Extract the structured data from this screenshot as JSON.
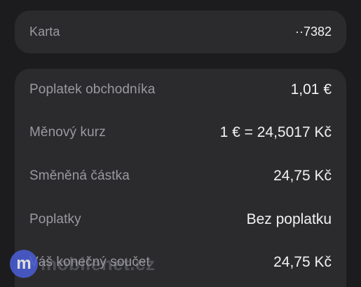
{
  "card_section": {
    "label": "Karta",
    "value": "··7382"
  },
  "details": {
    "rows": [
      {
        "label": "Poplatek obchodníka",
        "value": "1,01 €"
      },
      {
        "label": "Měnový kurz",
        "value": "1 € = 24,5017 Kč"
      },
      {
        "label": "Směněná částka",
        "value": "24,75 Kč"
      },
      {
        "label": "Poplatky",
        "value": "Bez poplatku"
      },
      {
        "label": "Váš konečný součet",
        "value": "24,75 Kč"
      }
    ]
  },
  "watermark": {
    "logo_letter": "m",
    "text": "mobilenet.cz"
  }
}
